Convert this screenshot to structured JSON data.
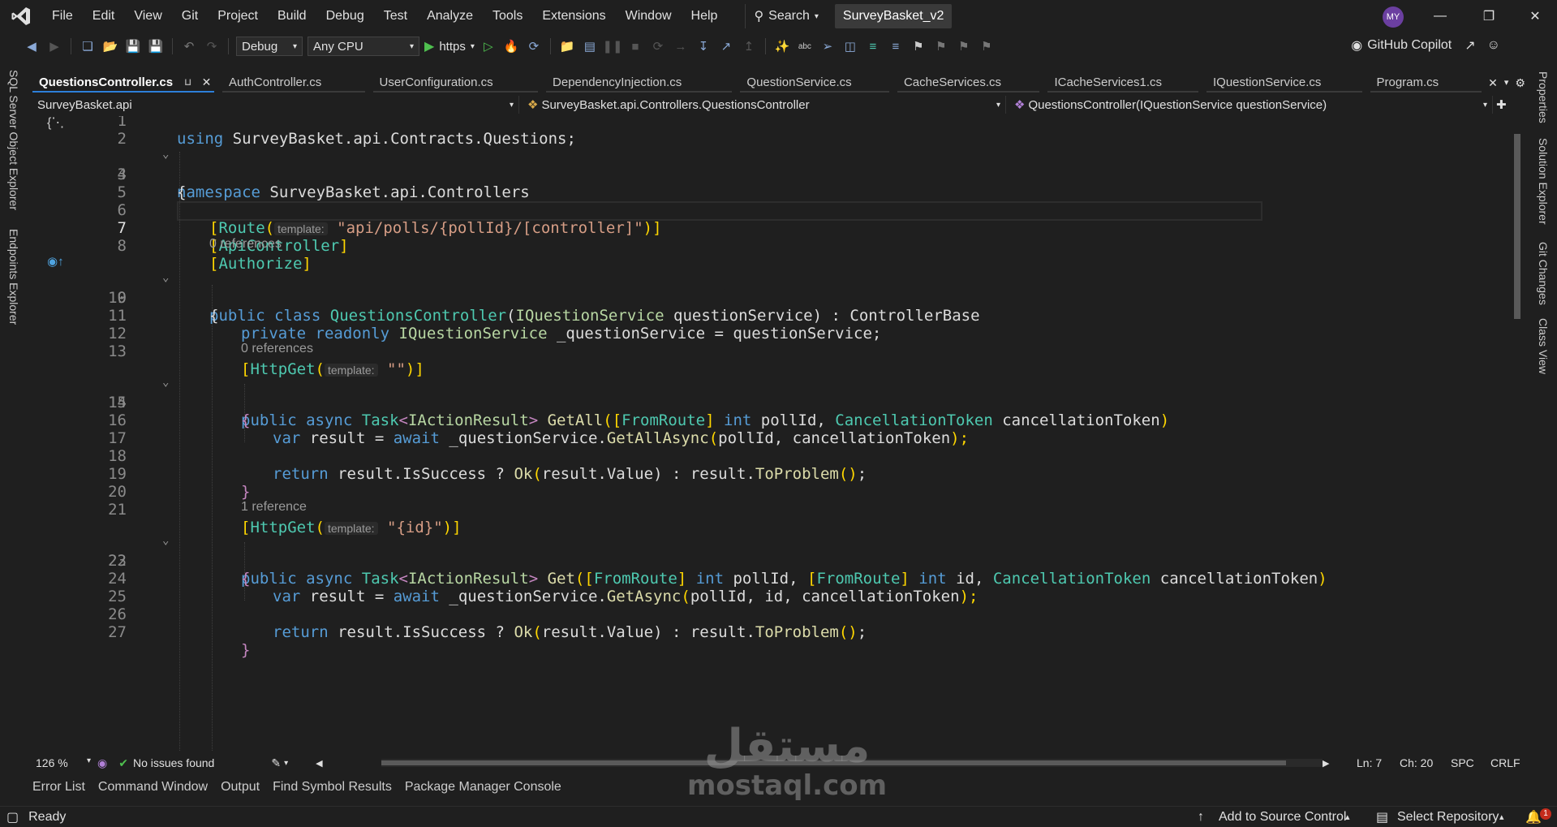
{
  "menubar": {
    "items": [
      "File",
      "Edit",
      "View",
      "Git",
      "Project",
      "Build",
      "Debug",
      "Test",
      "Analyze",
      "Tools",
      "Extensions",
      "Window",
      "Help"
    ],
    "search_label": "Search",
    "solution_title": "SurveyBasket_v2",
    "avatar_initials": "MY"
  },
  "toolbar": {
    "configuration": "Debug",
    "platform": "Any CPU",
    "run_profile": "https",
    "copilot_label": "GitHub Copilot"
  },
  "left_vtabs": [
    "SQL Server Object Explorer",
    "Endpoints Explorer"
  ],
  "right_vtabs": [
    "Properties",
    "Solution Explorer",
    "Git Changes",
    "Class View"
  ],
  "doc_tabs": [
    {
      "label": "QuestionsController.cs",
      "active": true
    },
    {
      "label": "AuthController.cs"
    },
    {
      "label": "UserConfiguration.cs"
    },
    {
      "label": "DependencyInjection.cs"
    },
    {
      "label": "QuestionService.cs"
    },
    {
      "label": "CacheServices.cs"
    },
    {
      "label": "ICacheServices1.cs"
    },
    {
      "label": "IQuestionService.cs"
    },
    {
      "label": "Program.cs"
    }
  ],
  "navbar": {
    "project": "SurveyBasket.api",
    "type": "SurveyBasket.api.Controllers.QuestionsController",
    "member": "QuestionsController(IQuestionService questionService)"
  },
  "code": {
    "line_numbers": [
      "1",
      "2",
      "3",
      "4",
      "5",
      "6",
      "7",
      "8",
      "9",
      "10",
      "11",
      "12",
      "13",
      "14",
      "15",
      "16",
      "17",
      "18",
      "19",
      "20",
      "21",
      "22",
      "23",
      "24",
      "25",
      "26",
      "27"
    ],
    "refs": [
      "0 references",
      "0 references",
      "1 reference"
    ],
    "hints": [
      "template:",
      "template:",
      "template:"
    ],
    "l1": [
      "using",
      "SurveyBasket.api.Contracts.Questions;"
    ],
    "l3": [
      "namespace",
      "SurveyBasket.api.Controllers"
    ],
    "l4": "{",
    "l6": [
      "[",
      "Route",
      "(",
      "\"api/polls/{pollId}/[controller]\"",
      ")]"
    ],
    "l7": [
      "[",
      "ApiController",
      "]"
    ],
    "l8": [
      "[",
      "Authorize",
      "]"
    ],
    "l9": [
      "public",
      "class",
      "QuestionsController",
      "(",
      "IQuestionService",
      "questionService",
      ") : ",
      "ControllerBase"
    ],
    "l10": "{",
    "l11": [
      "private",
      "readonly",
      "IQuestionService",
      "_questionService = questionService;"
    ],
    "l13": [
      "[",
      "HttpGet",
      "(",
      "\"\"",
      ")]"
    ],
    "l14": [
      "public",
      "async",
      "Task",
      "<",
      "IActionResult",
      ">",
      "GetAll",
      "(",
      "[",
      "FromRoute",
      "]",
      "int",
      "pollId, ",
      "CancellationToken",
      "cancellationToken",
      ")"
    ],
    "l15": "{",
    "l16": [
      "var",
      "result = ",
      "await",
      "_questionService.",
      "GetAllAsync",
      "(",
      "pollId, cancellationToken",
      ");"
    ],
    "l18": [
      "return",
      "result.IsSuccess ? ",
      "Ok",
      "(",
      "result.Value",
      ") : result.",
      "ToProblem",
      "()",
      ";"
    ],
    "l19": "}",
    "l21": [
      "[",
      "HttpGet",
      "(",
      "\"{id}\"",
      ")]"
    ],
    "l22": [
      "public",
      "async",
      "Task",
      "<",
      "IActionResult",
      ">",
      "Get",
      "(",
      "[",
      "FromRoute",
      "]",
      "int",
      "pollId, ",
      "[",
      "FromRoute",
      "]",
      "int",
      "id, ",
      "CancellationToken",
      "cancellationToken",
      ")"
    ],
    "l23": "{",
    "l24": [
      "var",
      "result = ",
      "await",
      "_questionService.",
      "GetAsync",
      "(",
      "pollId, id, cancellationToken",
      ");"
    ],
    "l26": [
      "return",
      "result.IsSuccess ? ",
      "Ok",
      "(",
      "result.Value",
      ") : result.",
      "ToProblem",
      "()",
      ";"
    ],
    "l27": "}"
  },
  "editor_status": {
    "zoom": "126 %",
    "issues": "No issues found",
    "line": "Ln: 7",
    "column": "Ch: 20",
    "indent": "SPC",
    "line_ending": "CRLF"
  },
  "tool_tabs": [
    "Error List",
    "Command Window",
    "Output",
    "Find Symbol Results",
    "Package Manager Console"
  ],
  "statusbar": {
    "ready": "Ready",
    "source_control": "Add to Source Control",
    "repository": "Select Repository",
    "notifications": "1"
  },
  "watermark": {
    "arabic": "مستقل",
    "latin": "mostaql.com"
  },
  "colors": {
    "background": "#1f1f1f",
    "keyword": "#569cd6",
    "type": "#4ec9b0",
    "string": "#d69d85",
    "method": "#dcdcaa",
    "accent": "#2d7fd9"
  }
}
